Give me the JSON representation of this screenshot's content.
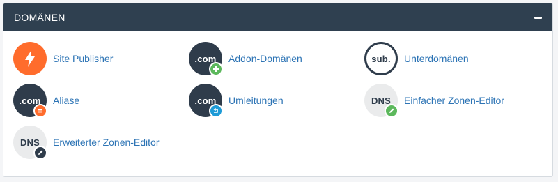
{
  "panel": {
    "title": "DOMÄNEN",
    "colors": {
      "header_bg": "#2f4050",
      "link": "#2d74b5"
    }
  },
  "items": [
    {
      "label": "Site Publisher",
      "icon": "lightning-bolt-icon",
      "icon_text": ""
    },
    {
      "label": "Addon-Domänen",
      "icon": "dot-com-icon",
      "icon_text": ".com",
      "badge": "plus-badge-icon"
    },
    {
      "label": "Unterdomänen",
      "icon": "sub-icon",
      "icon_text": "sub."
    },
    {
      "label": "Aliase",
      "icon": "dot-com-icon",
      "icon_text": ".com",
      "badge": "equals-badge-icon"
    },
    {
      "label": "Umleitungen",
      "icon": "dot-com-icon",
      "icon_text": ".com",
      "badge": "redirect-badge-icon"
    },
    {
      "label": "Einfacher Zonen-Editor",
      "icon": "dns-icon",
      "icon_text": "DNS",
      "badge": "pencil-badge-icon"
    },
    {
      "label": "Erweiterter Zonen-Editor",
      "icon": "dns-icon",
      "icon_text": "DNS",
      "badge": "pencil-badge-icon"
    }
  ]
}
